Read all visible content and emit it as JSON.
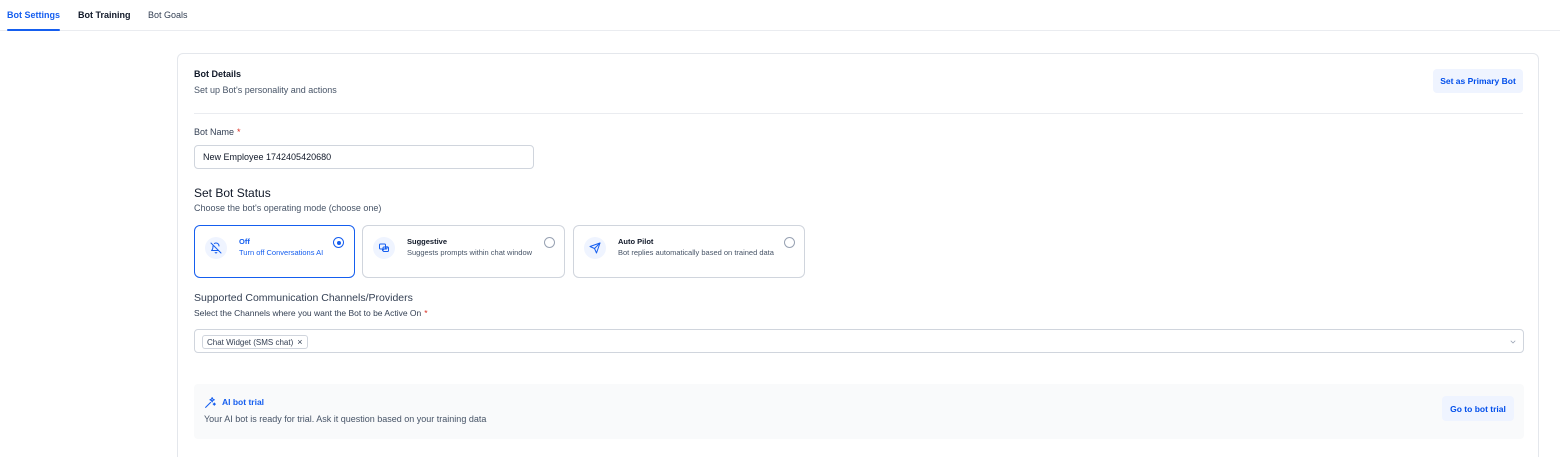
{
  "tabs": [
    {
      "label": "Bot Settings",
      "active": true
    },
    {
      "label": "Bot Training",
      "active": false
    },
    {
      "label": "Bot Goals",
      "active": false
    }
  ],
  "bot_details": {
    "title": "Bot Details",
    "subtitle": "Set up Bot's personality and actions",
    "primary_button": "Set as Primary Bot"
  },
  "bot_name": {
    "label": "Bot Name",
    "required_mark": "*",
    "value": "New Employee 1742405420680"
  },
  "status": {
    "title": "Set Bot Status",
    "subtitle": "Choose the bot's operating mode (choose one)",
    "options": [
      {
        "title": "Off",
        "desc": "Turn off Conversations AI",
        "icon": "bell-off-icon",
        "selected": true
      },
      {
        "title": "Suggestive",
        "desc": "Suggests prompts within chat window",
        "icon": "chat-bubbles-icon",
        "selected": false
      },
      {
        "title": "Auto Pilot",
        "desc": "Bot replies automatically based on trained data",
        "icon": "send-icon",
        "selected": false
      }
    ]
  },
  "channels": {
    "title": "Supported Communication Channels/Providers",
    "label": "Select the Channels where you want the Bot to be Active On",
    "required_mark": "*",
    "selected": [
      "Chat Widget (SMS chat)"
    ],
    "remove_glyph": "×"
  },
  "trial": {
    "title": "AI bot trial",
    "desc": "Your AI bot is ready for trial. Ask it question based on your training data",
    "button": "Go to bot trial"
  },
  "colors": {
    "accent": "#155eef",
    "required": "#d92d20",
    "button_bg": "#eff4ff"
  }
}
